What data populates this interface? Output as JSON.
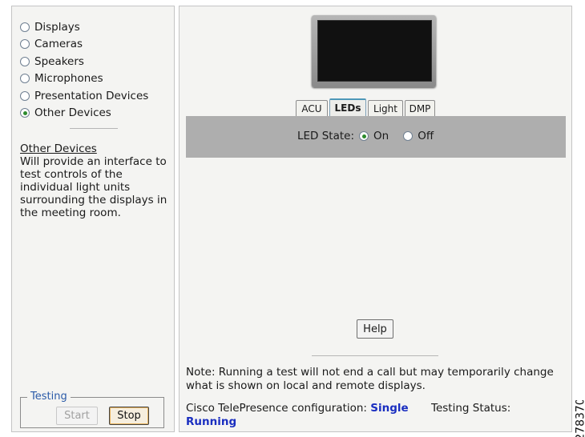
{
  "left_panel": {
    "radio_items": [
      {
        "label": "Displays",
        "checked": false
      },
      {
        "label": "Cameras",
        "checked": false
      },
      {
        "label": "Speakers",
        "checked": false
      },
      {
        "label": "Microphones",
        "checked": false
      },
      {
        "label": "Presentation Devices",
        "checked": false
      },
      {
        "label": "Other Devices",
        "checked": true
      }
    ],
    "info_title": "Other Devices",
    "info_description": "Will provide an interface to test controls of the individual light units surrounding the displays in the meeting room.",
    "testing": {
      "legend": "Testing",
      "start_label": "Start",
      "stop_label": "Stop"
    }
  },
  "right_panel": {
    "tabs": [
      {
        "label": "ACU",
        "active": false
      },
      {
        "label": "LEDs",
        "active": true
      },
      {
        "label": "Light",
        "active": false
      },
      {
        "label": "DMP",
        "active": false
      }
    ],
    "led_state": {
      "label": "LED State:",
      "options": [
        {
          "label": "On",
          "checked": true
        },
        {
          "label": "Off",
          "checked": false
        }
      ]
    },
    "help_label": "Help",
    "note": "Note: Running a test will not end a call but may temporarily change what is shown on local and remote displays.",
    "config_label": "Cisco TelePresence configuration:",
    "config_value": "Single",
    "status_label": "Testing Status:",
    "status_value": "Running"
  },
  "figure_id": "278370",
  "colors": {
    "panel_bg": "#f4f4f2",
    "content_bar": "#aeaeae",
    "accent_blue": "#1a2ec0",
    "legend_blue": "#2a5aa8",
    "radio_checked": "#2c8a2c"
  }
}
